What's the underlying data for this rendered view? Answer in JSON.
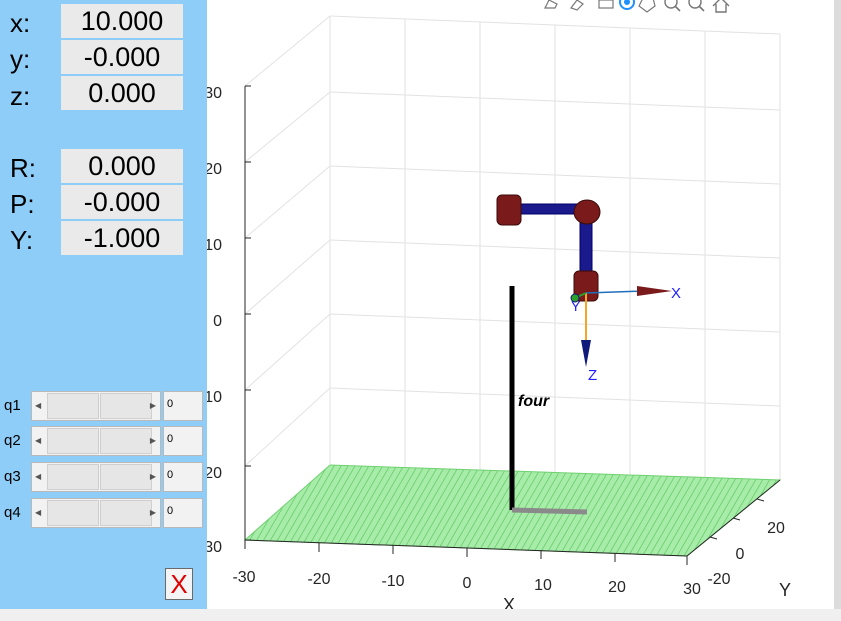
{
  "pose": {
    "x_label": "x:",
    "x_value": "10.000",
    "y_label": "y:",
    "y_value": "-0.000",
    "z_label": "z:",
    "z_value": "0.000",
    "r_label": "R:",
    "r_value": "0.000",
    "p_label": "P:",
    "p_value": "-0.000",
    "yaw_label": "Y:",
    "yaw_value": "-1.000"
  },
  "joints": [
    {
      "label": "q1",
      "value": "0"
    },
    {
      "label": "q2",
      "value": "0"
    },
    {
      "label": "q3",
      "value": "0"
    },
    {
      "label": "q4",
      "value": "0"
    }
  ],
  "close_button": "X",
  "axes": {
    "x_ticks": [
      "-30",
      "-20",
      "-10",
      "0",
      "10",
      "20",
      "30"
    ],
    "x_label": "X",
    "y_ticks": [
      "-20",
      "0",
      "20"
    ],
    "y_label": "Y",
    "z_ticks": [
      "30",
      "20",
      "10",
      "0",
      "10",
      "20",
      "30"
    ]
  },
  "frame_labels": {
    "x": "X",
    "y": "Y",
    "z": "Z"
  },
  "object_label": "four",
  "colors": {
    "panel": "#8ecdf7",
    "floor": "#8fe08f",
    "link": "#1a1a8c",
    "joint": "#7a1a1a",
    "close": "#e00000"
  },
  "toolbar_icons": [
    "brush-icon",
    "data-cursor-icon",
    "save-icon",
    "rotate-icon",
    "pan-icon",
    "zoom-in-icon",
    "zoom-out-icon",
    "home-icon"
  ]
}
